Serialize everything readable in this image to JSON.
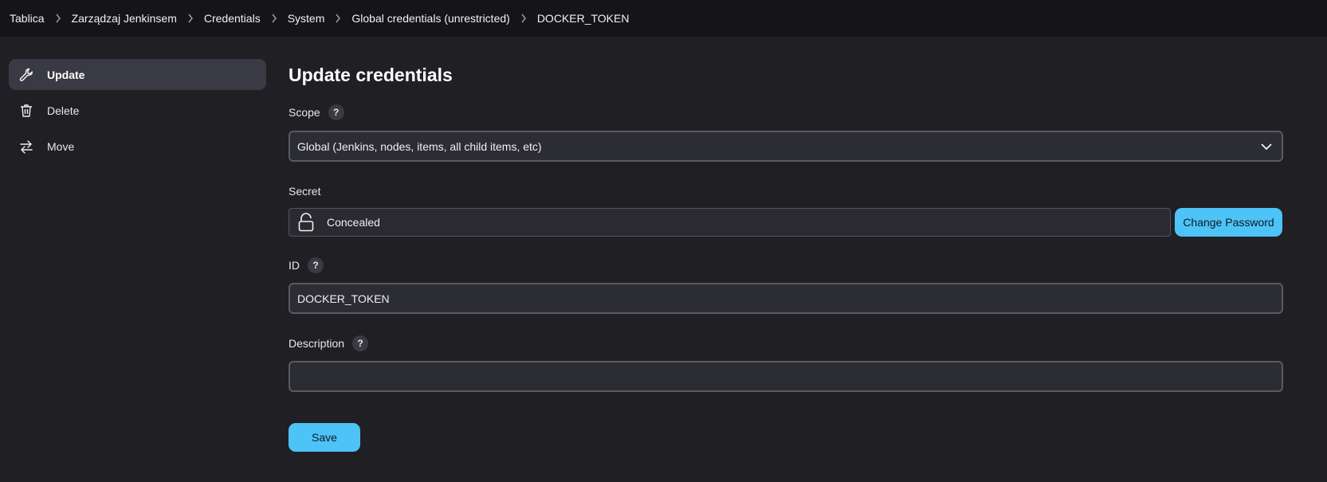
{
  "breadcrumb": [
    "Tablica",
    "Zarządzaj Jenkinsem",
    "Credentials",
    "System",
    "Global credentials (unrestricted)",
    "DOCKER_TOKEN"
  ],
  "sidebar": {
    "items": [
      {
        "label": "Update",
        "icon": "wrench-icon",
        "active": true
      },
      {
        "label": "Delete",
        "icon": "trash-icon",
        "active": false
      },
      {
        "label": "Move",
        "icon": "arrows-swap-icon",
        "active": false
      }
    ]
  },
  "main": {
    "title": "Update credentials",
    "scope": {
      "label": "Scope",
      "help": "?",
      "value": "Global (Jenkins, nodes, items, all child items, etc)"
    },
    "secret": {
      "label": "Secret",
      "value": "Concealed",
      "button": "Change Password"
    },
    "id": {
      "label": "ID",
      "help": "?",
      "value": "DOCKER_TOKEN"
    },
    "description": {
      "label": "Description",
      "help": "?",
      "value": ""
    },
    "save_label": "Save"
  },
  "colors": {
    "accent": "#4ec3f7",
    "background": "#1f1f24",
    "topbar": "#151518"
  }
}
